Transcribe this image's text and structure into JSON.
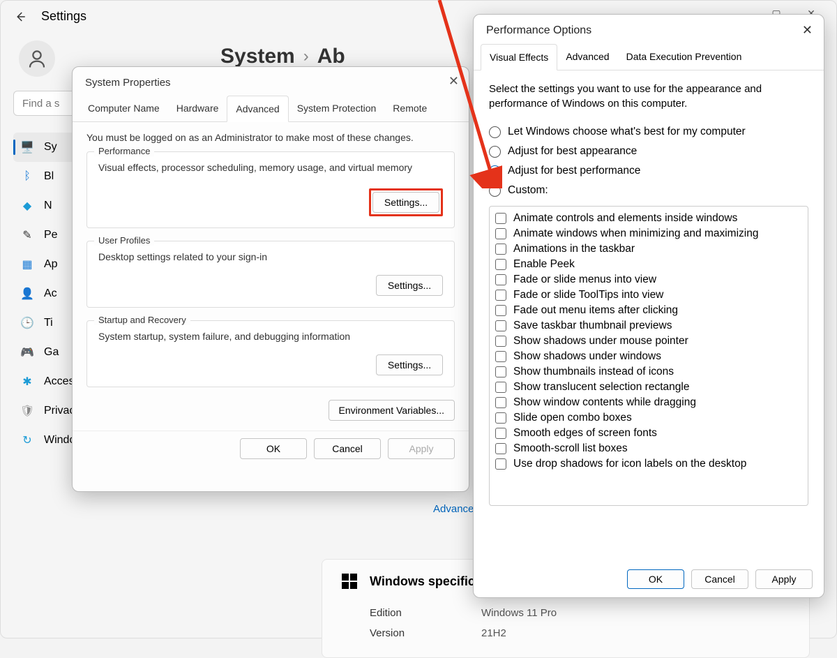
{
  "settings": {
    "title": "Settings",
    "search_placeholder": "Find a s",
    "breadcrumb": {
      "root": "System",
      "page": "Ab"
    },
    "nav": [
      {
        "label": "Sy",
        "icon": "🖥️",
        "key": "system",
        "color": "#1c7cd6"
      },
      {
        "label": "Bl",
        "icon": "ᛒ",
        "key": "bluetooth",
        "color": "#1c7cd6"
      },
      {
        "label": "N",
        "icon": "◆",
        "key": "network",
        "color": "#1c9bd6"
      },
      {
        "label": "Pe",
        "icon": "✎",
        "key": "personalization",
        "color": "#333"
      },
      {
        "label": "Ap",
        "icon": "▦",
        "key": "apps",
        "color": "#1c7cd6"
      },
      {
        "label": "Ac",
        "icon": "👤",
        "key": "accounts",
        "color": "#1c9bd6"
      },
      {
        "label": "Ti",
        "icon": "🕒",
        "key": "time",
        "color": "#1c9bd6"
      },
      {
        "label": "Ga",
        "icon": "🎮",
        "key": "gaming",
        "color": "#888"
      },
      {
        "label": "Accessibility",
        "icon": "✱",
        "key": "accessibility",
        "color": "#1c9bd6"
      },
      {
        "label": "Privacy & security",
        "icon": "🛡",
        "key": "privacy",
        "color": "#888"
      },
      {
        "label": "Windows Update",
        "icon": "↻",
        "key": "update",
        "color": "#1c9bd6"
      }
    ],
    "advanced_link": "Advanced s",
    "spec": {
      "heading": "Windows specification",
      "rows": [
        {
          "label": "Edition",
          "value": "Windows 11 Pro"
        },
        {
          "label": "Version",
          "value": "21H2"
        }
      ]
    }
  },
  "system_properties": {
    "title": "System Properties",
    "tabs": [
      "Computer Name",
      "Hardware",
      "Advanced",
      "System Protection",
      "Remote"
    ],
    "active_tab": "Advanced",
    "note": "You must be logged on as an Administrator to make most of these changes.",
    "groups": {
      "performance": {
        "title": "Performance",
        "desc": "Visual effects, processor scheduling, memory usage, and virtual memory",
        "button": "Settings..."
      },
      "profiles": {
        "title": "User Profiles",
        "desc": "Desktop settings related to your sign-in",
        "button": "Settings..."
      },
      "startup": {
        "title": "Startup and Recovery",
        "desc": "System startup, system failure, and debugging information",
        "button": "Settings..."
      }
    },
    "env_button": "Environment Variables...",
    "footer": {
      "ok": "OK",
      "cancel": "Cancel",
      "apply": "Apply"
    }
  },
  "performance_options": {
    "title": "Performance Options",
    "tabs": [
      "Visual Effects",
      "Advanced",
      "Data Execution Prevention"
    ],
    "active_tab": "Visual Effects",
    "intro": "Select the settings you want to use for the appearance and performance of Windows on this computer.",
    "radios": [
      {
        "label": "Let Windows choose what's best for my computer",
        "checked": false
      },
      {
        "label": "Adjust for best appearance",
        "checked": false
      },
      {
        "label": "Adjust for best performance",
        "checked": true
      },
      {
        "label": "Custom:",
        "checked": false
      }
    ],
    "checks": [
      "Animate controls and elements inside windows",
      "Animate windows when minimizing and maximizing",
      "Animations in the taskbar",
      "Enable Peek",
      "Fade or slide menus into view",
      "Fade or slide ToolTips into view",
      "Fade out menu items after clicking",
      "Save taskbar thumbnail previews",
      "Show shadows under mouse pointer",
      "Show shadows under windows",
      "Show thumbnails instead of icons",
      "Show translucent selection rectangle",
      "Show window contents while dragging",
      "Slide open combo boxes",
      "Smooth edges of screen fonts",
      "Smooth-scroll list boxes",
      "Use drop shadows for icon labels on the desktop"
    ],
    "footer": {
      "ok": "OK",
      "cancel": "Cancel",
      "apply": "Apply"
    }
  }
}
